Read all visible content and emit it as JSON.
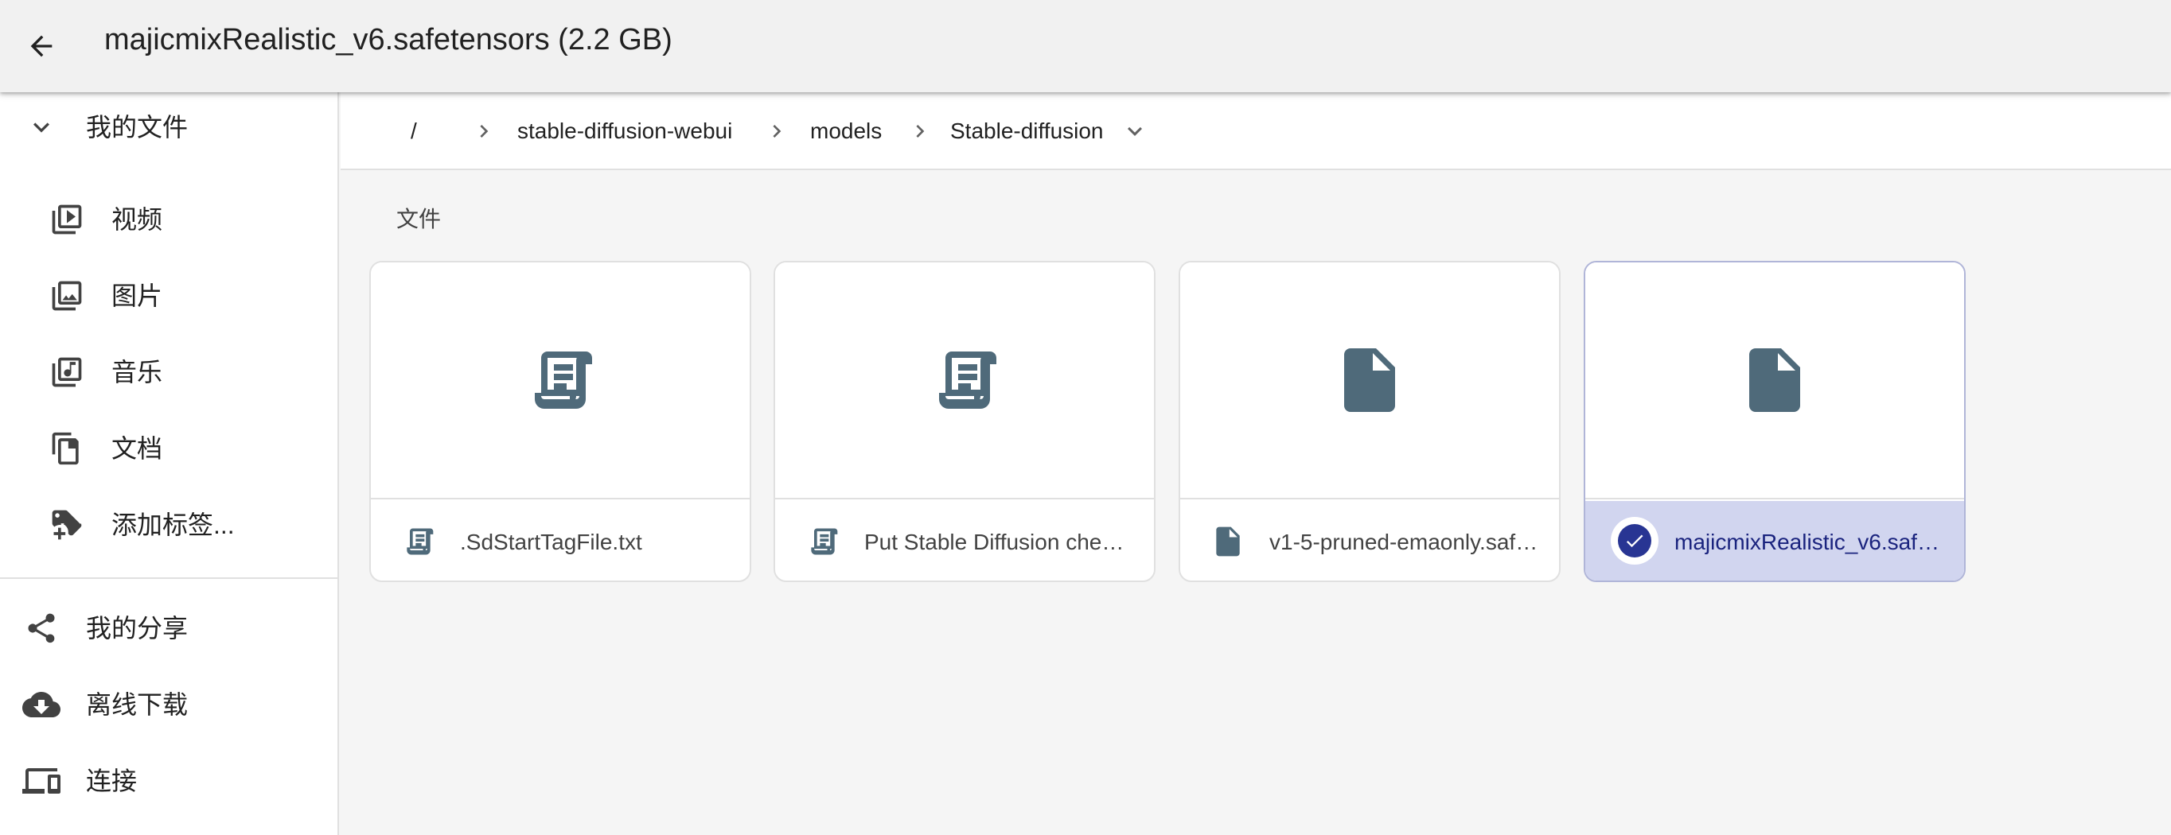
{
  "topbar": {
    "title": "majicmixRealistic_v6.safetensors (2.2 GB)"
  },
  "sidebar": {
    "header": {
      "label": "我的文件",
      "icon": "chevron-down-icon"
    },
    "items": [
      {
        "label": "视频",
        "icon": "video-library-icon"
      },
      {
        "label": "图片",
        "icon": "photo-library-icon"
      },
      {
        "label": "音乐",
        "icon": "music-library-icon"
      },
      {
        "label": "文档",
        "icon": "documents-icon"
      },
      {
        "label": "添加标签...",
        "icon": "add-tag-icon"
      }
    ],
    "bottom_items": [
      {
        "label": "我的分享",
        "icon": "share-icon"
      },
      {
        "label": "离线下载",
        "icon": "cloud-download-icon"
      },
      {
        "label": "连接",
        "icon": "devices-icon"
      }
    ]
  },
  "breadcrumb": {
    "root": "/",
    "parts": [
      "stable-diffusion-webui",
      "models",
      "Stable-diffusion"
    ]
  },
  "files_section": {
    "label": "文件",
    "files": [
      {
        "name": ".SdStartTagFile.txt",
        "icon": "text-scroll-icon",
        "selected": false
      },
      {
        "name": "Put Stable Diffusion checkpoints here.txt",
        "icon": "text-scroll-icon",
        "selected": false
      },
      {
        "name": "v1-5-pruned-emaonly.safetensors",
        "icon": "file-icon",
        "selected": false
      },
      {
        "name": "majicmixRealistic_v6.safetensors",
        "icon": "file-icon",
        "selected": true
      }
    ]
  },
  "colors": {
    "icon": "#4f6a7a",
    "selected_bg": "#d1d5ef",
    "selected_check": "#283593"
  }
}
